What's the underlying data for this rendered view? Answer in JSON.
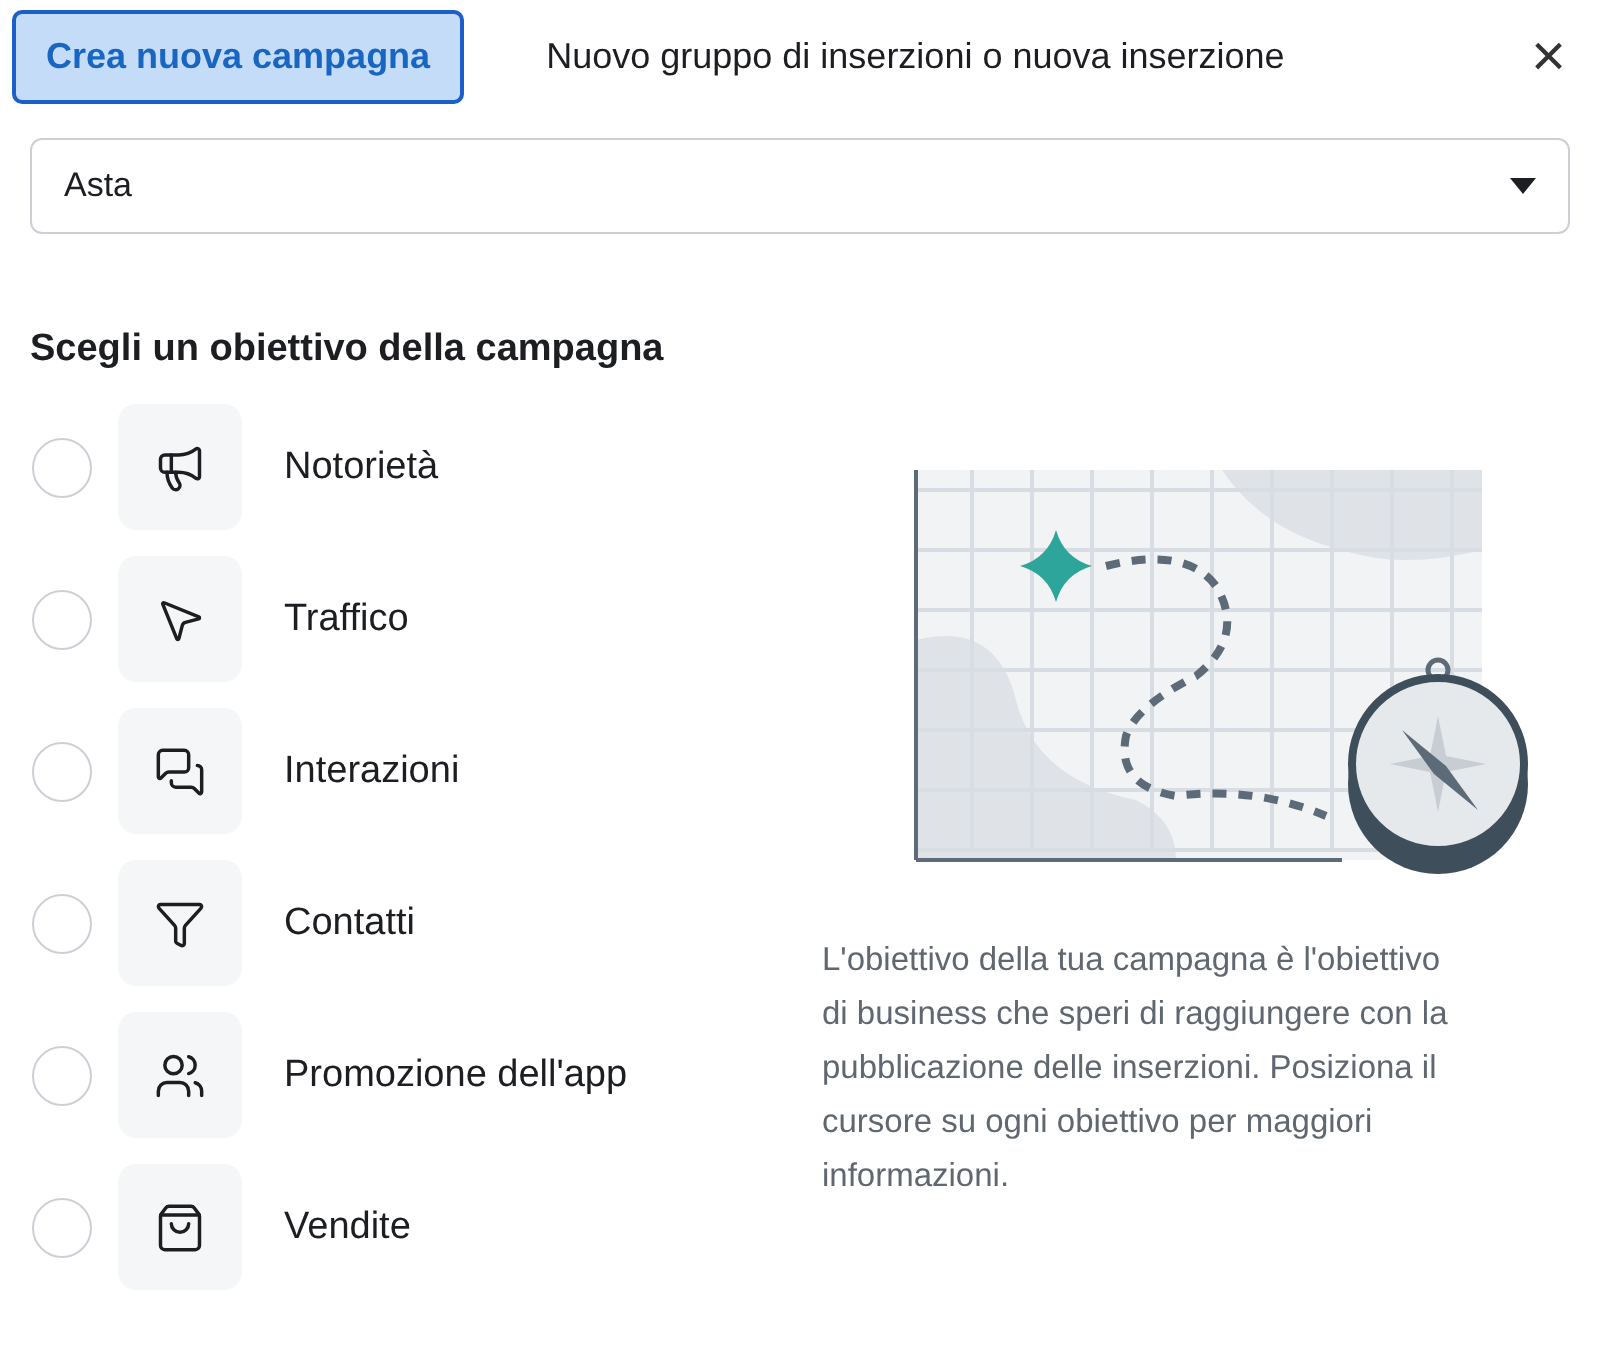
{
  "tabs": [
    {
      "label": "Crea nuova campagna",
      "selected": true
    },
    {
      "label": "Nuovo gruppo di inserzioni o nuova inserzione",
      "selected": false
    }
  ],
  "close": "×",
  "buying_type": {
    "value": "Asta"
  },
  "heading": "Scegli un obiettivo della campagna",
  "objectives": [
    {
      "label": "Notorietà",
      "selected": false
    },
    {
      "label": "Traffico",
      "selected": false
    },
    {
      "label": "Interazioni",
      "selected": false
    },
    {
      "label": "Contatti",
      "selected": false
    },
    {
      "label": "Promozione dell'app",
      "selected": false
    },
    {
      "label": "Vendite",
      "selected": false
    }
  ],
  "description": "L'obiettivo della tua campagna è l'obiettivo di business che speri di raggiungere con la pubblicazione delle inserzioni. Posiziona il cursore su ogni obiettivo per maggiori informazioni."
}
